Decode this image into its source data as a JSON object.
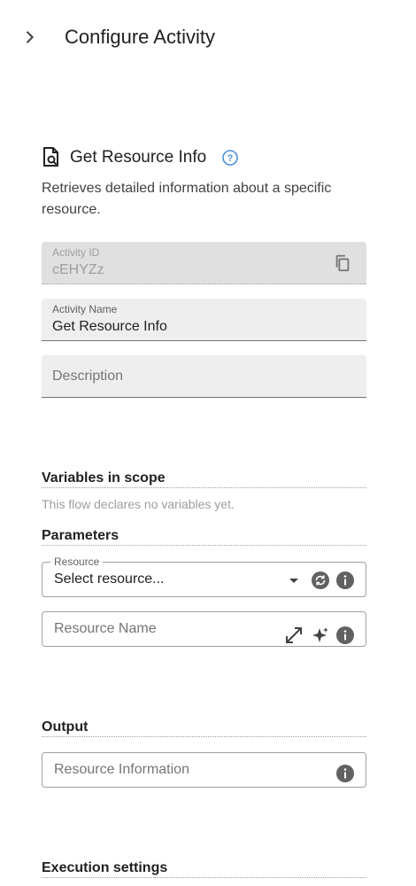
{
  "header": {
    "title": "Configure Activity",
    "collapse_icon": "chevron-right-icon"
  },
  "activity": {
    "icon": "resource-doc-icon",
    "title": "Get Resource Info",
    "help_icon": "help-circle-icon",
    "description": "Retrieves detailed information about a specific resource."
  },
  "fields": {
    "activity_id": {
      "label": "Activity ID",
      "value": "cEHYZz",
      "icon": "copy-icon"
    },
    "activity_name": {
      "label": "Activity Name",
      "value": "Get Resource Info"
    },
    "description": {
      "placeholder": "Description"
    }
  },
  "variables": {
    "heading": "Variables in scope",
    "empty_text": "This flow declares no variables yet."
  },
  "parameters": {
    "heading": "Parameters",
    "resource": {
      "label": "Resource",
      "value": "Select resource...",
      "icons": [
        "dropdown-arrow-icon",
        "refresh-icon",
        "info-icon"
      ]
    },
    "resource_name": {
      "placeholder": "Resource Name",
      "icons": [
        "expand-icon",
        "sparkle-icon",
        "info-icon"
      ]
    }
  },
  "output": {
    "heading": "Output",
    "resource_information": {
      "placeholder": "Resource Information",
      "icon": "info-icon"
    }
  },
  "execution": {
    "heading": "Execution settings"
  },
  "colors": {
    "accent": "#4a90d9",
    "field_bg": "#eeeeee",
    "disabled_bg": "#e0e0e0",
    "icon_gray": "#616161"
  }
}
